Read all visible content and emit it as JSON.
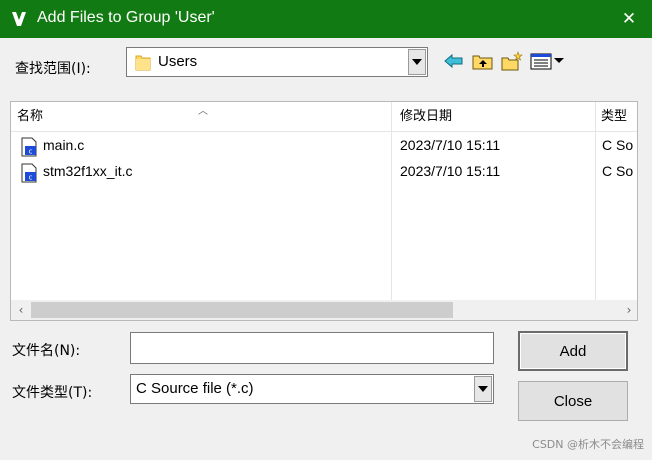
{
  "window": {
    "title": "Add Files to Group 'User'",
    "close_symbol": "✕"
  },
  "lookin": {
    "label": "查找范围(I):",
    "value": "Users"
  },
  "toolbar": {
    "icons": [
      "back-icon",
      "up-folder-icon",
      "new-folder-icon",
      "view-menu-icon"
    ]
  },
  "list": {
    "columns": [
      "名称",
      "修改日期",
      "类型"
    ],
    "rows": [
      {
        "name": "main.c",
        "date": "2023/7/10 15:11",
        "type": "C So"
      },
      {
        "name": "stm32f1xx_it.c",
        "date": "2023/7/10 15:11",
        "type": "C So"
      }
    ]
  },
  "filename": {
    "label": "文件名(N):",
    "value": ""
  },
  "filetype": {
    "label": "文件类型(T):",
    "value": "C Source file (*.c)"
  },
  "buttons": {
    "add": "Add",
    "close": "Close"
  },
  "watermark": "CSDN @析木不会编程",
  "colors": {
    "titlebar": "#127a12",
    "icon_blue": "#1e4bd8",
    "folder_yellow": "#ffd866"
  }
}
